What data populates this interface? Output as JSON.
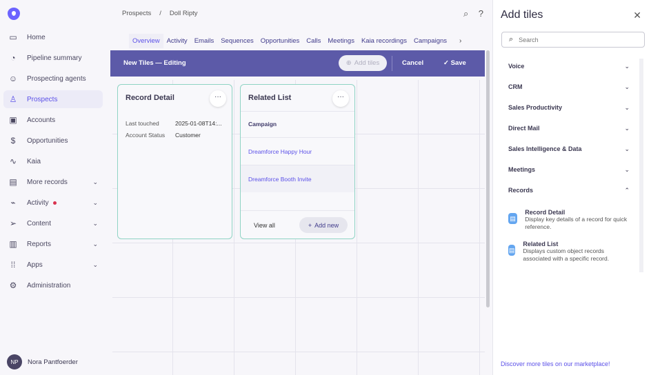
{
  "sidebar": {
    "items": [
      {
        "label": "Home",
        "icon": "home-icon"
      },
      {
        "label": "Pipeline summary",
        "icon": "pipeline-icon"
      },
      {
        "label": "Prospecting agents",
        "icon": "agent-icon"
      },
      {
        "label": "Prospects",
        "icon": "person-icon"
      },
      {
        "label": "Accounts",
        "icon": "briefcase-icon"
      },
      {
        "label": "Opportunities",
        "icon": "dollar-icon"
      },
      {
        "label": "Kaia",
        "icon": "waveform-icon"
      },
      {
        "label": "More records",
        "icon": "records-icon"
      },
      {
        "label": "Activity",
        "icon": "activity-icon"
      },
      {
        "label": "Content",
        "icon": "send-icon"
      },
      {
        "label": "Reports",
        "icon": "chart-icon"
      },
      {
        "label": "Apps",
        "icon": "grid-icon"
      },
      {
        "label": "Administration",
        "icon": "gear-icon"
      }
    ],
    "user": {
      "initials": "NP",
      "name": "Nora Pantfoerder"
    }
  },
  "breadcrumb": {
    "parent": "Prospects",
    "sep": "/",
    "current": "Doll Ripty"
  },
  "tabs": [
    "Overview",
    "Activity",
    "Emails",
    "Sequences",
    "Opportunities",
    "Calls",
    "Meetings",
    "Kaia recordings",
    "Campaigns"
  ],
  "editbar": {
    "title": "New Tiles — Editing",
    "add_tiles": "Add tiles",
    "cancel": "Cancel",
    "save": "Save"
  },
  "record_detail": {
    "title": "Record Detail",
    "fields": [
      {
        "label": "Last touched",
        "value": "2025-01-08T14:..."
      },
      {
        "label": "Account Status",
        "value": "Customer"
      }
    ]
  },
  "related_list": {
    "title": "Related List",
    "header": "Campaign",
    "rows": [
      "Dreamforce Happy Hour",
      "Dreamforce Booth Invite"
    ],
    "view_all": "View all",
    "add_new": "Add new"
  },
  "panel": {
    "title": "Add tiles",
    "search_placeholder": "Search",
    "categories": [
      "Voice",
      "CRM",
      "Sales Productivity",
      "Direct Mail",
      "Sales Intelligence & Data",
      "Meetings",
      "Records"
    ],
    "tiles": [
      {
        "name": "Record Detail",
        "desc": "Display key details of a record for quick reference."
      },
      {
        "name": "Related List",
        "desc": "Displays custom object records associated with a specific record."
      }
    ],
    "marketplace": "Discover more tiles on our marketplace!"
  }
}
